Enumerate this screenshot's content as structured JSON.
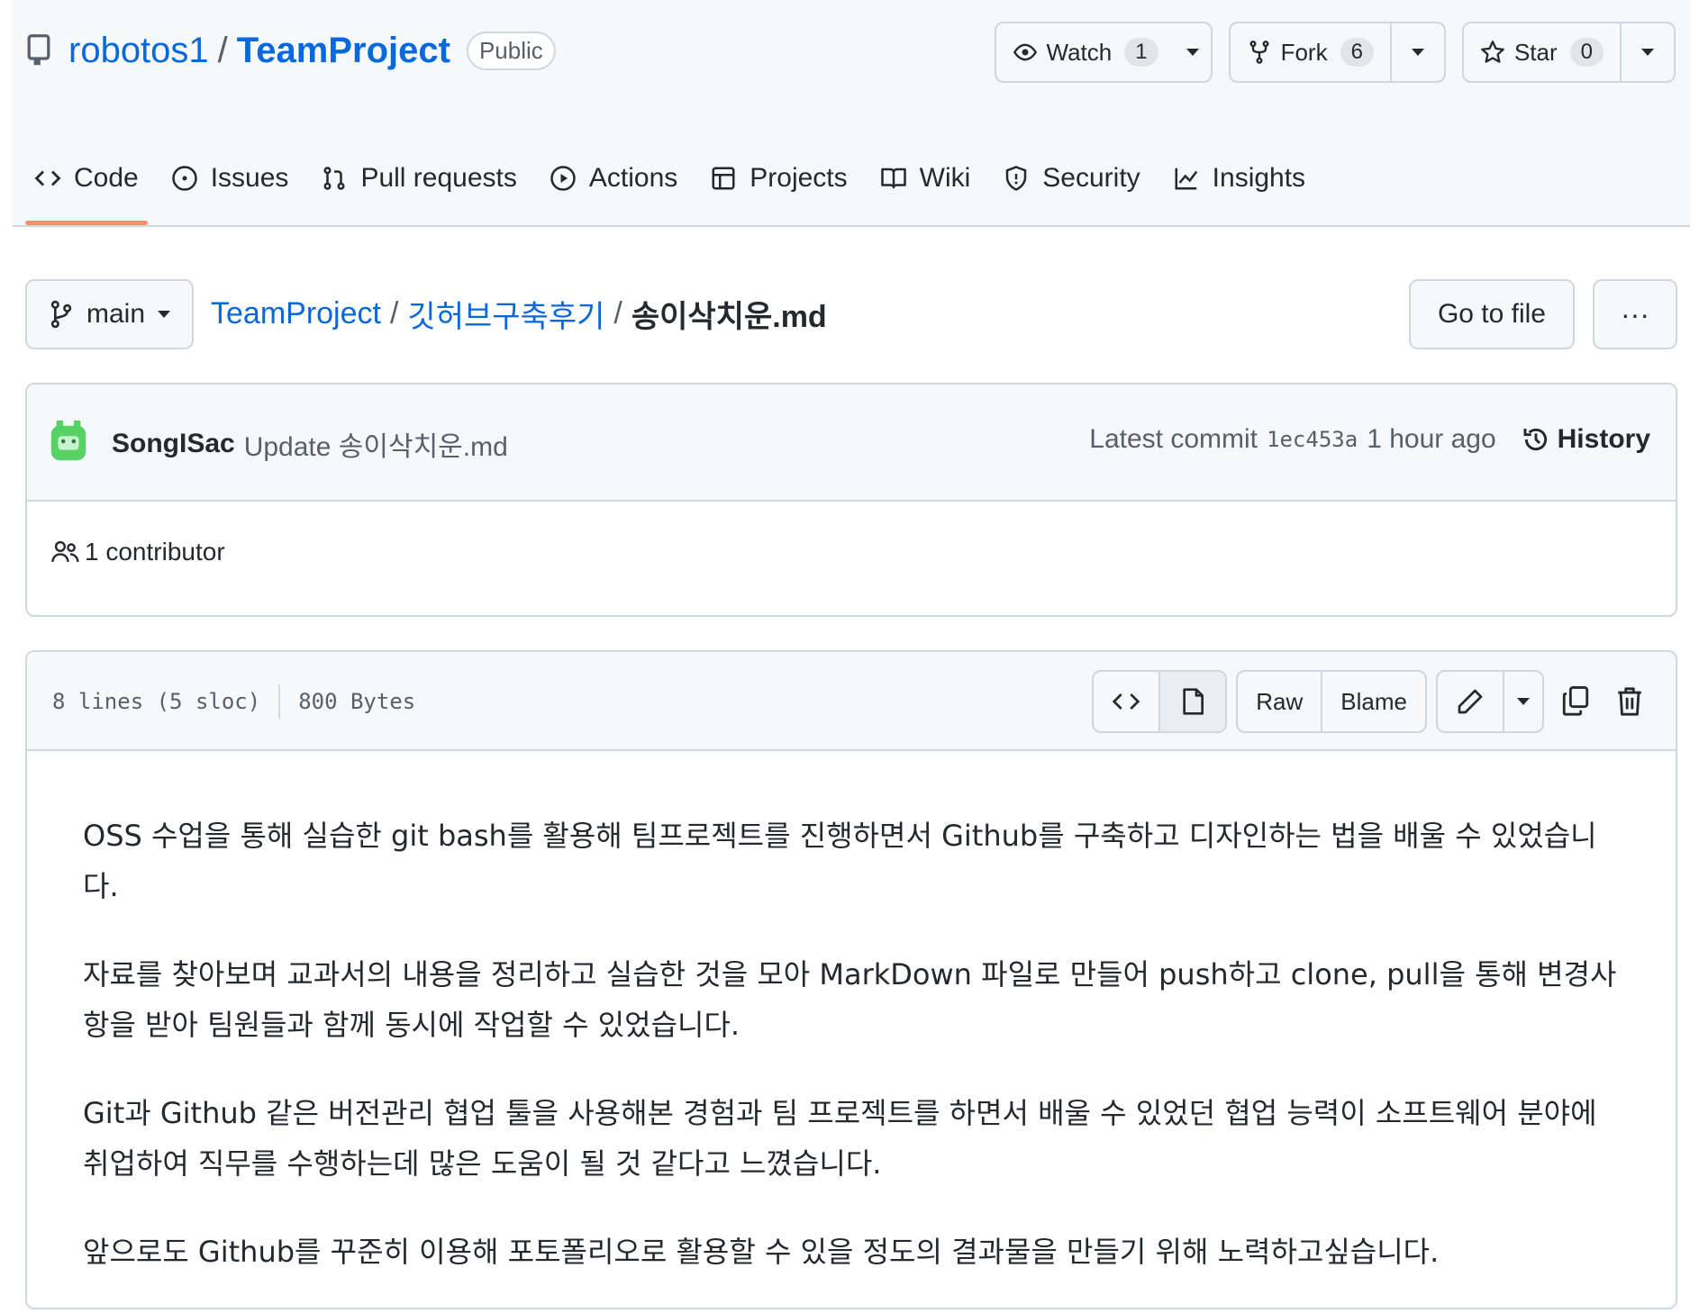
{
  "repo": {
    "owner": "robotos1",
    "separator": "/",
    "name": "TeamProject",
    "visibility": "Public"
  },
  "repo_actions": {
    "watch": {
      "label": "Watch",
      "count": "1"
    },
    "fork": {
      "label": "Fork",
      "count": "6"
    },
    "star": {
      "label": "Star",
      "count": "0"
    }
  },
  "tabs": [
    {
      "label": "Code",
      "icon": "code-icon",
      "active": true
    },
    {
      "label": "Issues",
      "icon": "issue-icon"
    },
    {
      "label": "Pull requests",
      "icon": "pull-request-icon"
    },
    {
      "label": "Actions",
      "icon": "play-icon"
    },
    {
      "label": "Projects",
      "icon": "table-icon"
    },
    {
      "label": "Wiki",
      "icon": "book-icon"
    },
    {
      "label": "Security",
      "icon": "shield-icon"
    },
    {
      "label": "Insights",
      "icon": "graph-icon"
    }
  ],
  "branch": "main",
  "breadcrumb": {
    "root": "TeamProject",
    "folder": "깃허브구축후기",
    "file": "송이삭치운.md",
    "sep": "/"
  },
  "goto_file": "Go to file",
  "more": "···",
  "commit": {
    "author": "SongISac",
    "message": "Update 송이삭치운.md",
    "latest_label": "Latest commit",
    "sha": "1ec453a",
    "time": "1 hour ago",
    "history": "History"
  },
  "contributors": "1 contributor",
  "file": {
    "lines": "8 lines (5 sloc)",
    "size": "800 Bytes",
    "raw": "Raw",
    "blame": "Blame"
  },
  "content": {
    "p1": "OSS 수업을 통해 실습한 git bash를 활용해 팀프로젝트를 진행하면서 Github를 구축하고 디자인하는 법을 배울 수 있었습니다.",
    "p2": "자료를 찾아보며 교과서의 내용을 정리하고 실습한 것을 모아 MarkDown 파일로 만들어 push하고 clone, pull을 통해 변경사항을 받아 팀원들과 함께 동시에 작업할 수 있었습니다.",
    "p3": "Git과 Github 같은 버전관리 협업 툴을 사용해본 경험과 팀 프로젝트를 하면서 배울 수 있었던 협업 능력이 소프트웨어 분야에 취업하여 직무를 수행하는데 많은 도움이 될 것 같다고 느꼈습니다.",
    "p4": "앞으로도 Github를 꾸준히 이용해 포토폴리오로 활용할 수 있을 정도의 결과물을 만들기 위해 노력하고싶습니다."
  },
  "colors": {
    "link": "#0969da",
    "active_tab_underline": "#fd8c73",
    "border": "#d0d7de",
    "header_bg": "#f6f8fa"
  }
}
